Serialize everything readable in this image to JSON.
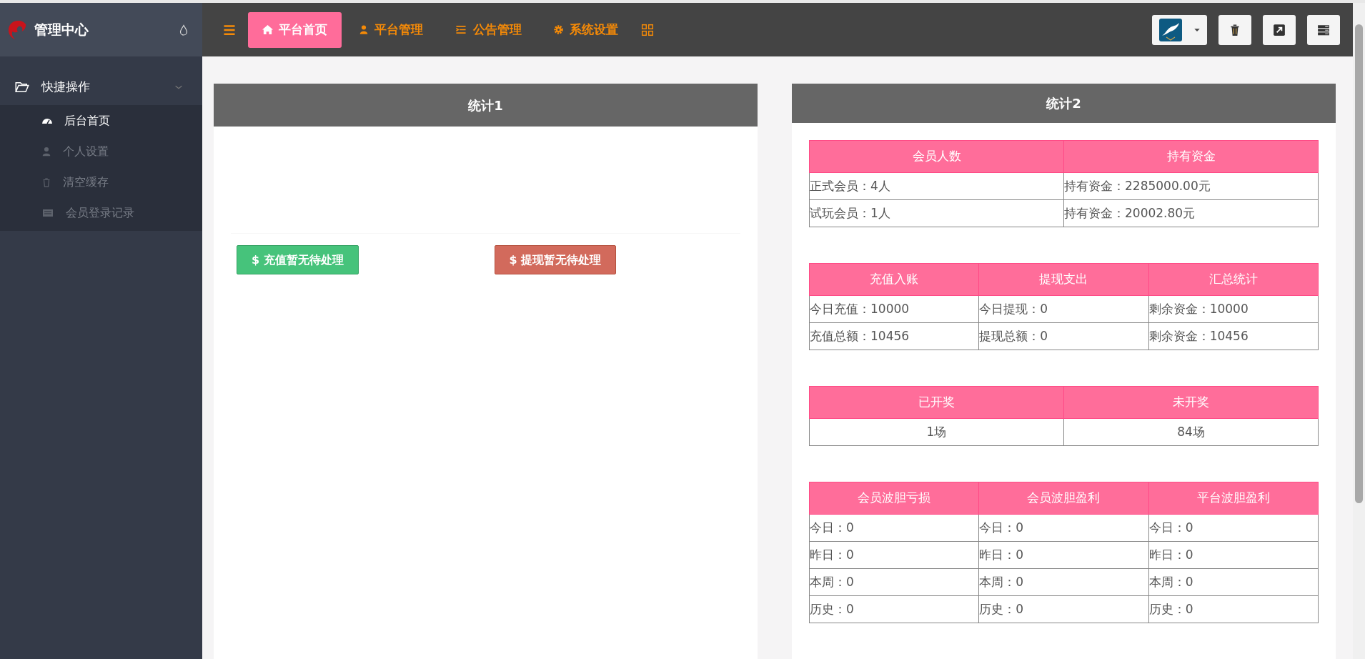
{
  "sidebar": {
    "brand": "管理中心",
    "group": {
      "label": "快捷操作",
      "expanded": true,
      "items": [
        {
          "label": "后台首页",
          "selected": true
        },
        {
          "label": "个人设置",
          "selected": false
        },
        {
          "label": "清空缓存",
          "selected": false
        },
        {
          "label": "会员登录记录",
          "selected": false
        }
      ]
    }
  },
  "topnav": {
    "tabs": [
      {
        "label": "平台首页",
        "selected": true
      },
      {
        "label": "平台管理",
        "selected": false
      },
      {
        "label": "公告管理",
        "selected": false
      },
      {
        "label": "系统设置",
        "selected": false
      }
    ]
  },
  "panels": [
    {
      "title": "统计1",
      "buttons": [
        {
          "label": "$ 充值暂无待处理",
          "kind": "success"
        },
        {
          "label": "$ 提现暂无待处理",
          "kind": "danger"
        }
      ]
    },
    {
      "title": "统计2",
      "tables": [
        {
          "centered": false,
          "columns": [
            "会员人数",
            "持有资金"
          ],
          "rows": [
            [
              "正式会员：4人",
              "持有资金：2285000.00元"
            ],
            [
              "试玩会员：1人",
              "持有资金：20002.80元"
            ]
          ]
        },
        {
          "centered": false,
          "columns": [
            "充值入账",
            "提现支出",
            "汇总统计"
          ],
          "rows": [
            [
              "今日充值：10000",
              "今日提现：0",
              "剩余资金：10000"
            ],
            [
              "充值总额：10456",
              "提现总额：0",
              "剩余资金：10456"
            ]
          ]
        },
        {
          "centered": true,
          "columns": [
            "已开奖",
            "未开奖"
          ],
          "rows": [
            [
              "1场",
              "84场"
            ]
          ]
        },
        {
          "centered": false,
          "columns": [
            "会员波胆亏损",
            "会员波胆盈利",
            "平台波胆盈利"
          ],
          "rows": [
            [
              "今日：0",
              "今日：0",
              "今日：0"
            ],
            [
              "昨日：0",
              "昨日：0",
              "昨日：0"
            ],
            [
              "本周：0",
              "本周：0",
              "本周：0"
            ],
            [
              "历史：0",
              "历史：0",
              "历史：0"
            ]
          ]
        }
      ]
    }
  ]
}
